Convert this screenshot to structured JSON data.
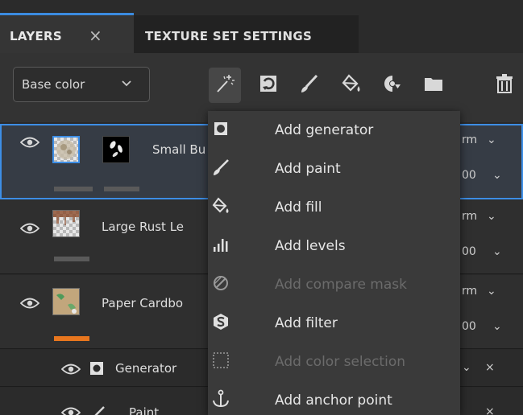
{
  "tabs": {
    "layers_label": "LAYERS",
    "layers_close": "×",
    "texture_set_label": "TEXTURE SET SETTINGS"
  },
  "toolbar": {
    "channel_value": "Base color",
    "buttons": [
      {
        "icon": "magic-wand-icon"
      },
      {
        "icon": "smart-mask-icon"
      },
      {
        "icon": "brush-icon"
      },
      {
        "icon": "fill-bucket-icon"
      },
      {
        "icon": "mask-icon"
      },
      {
        "icon": "folder-icon"
      },
      {
        "icon": "trash-icon"
      }
    ]
  },
  "layers": [
    {
      "name": "Small Bu",
      "blend": "rm",
      "opacity": "00"
    },
    {
      "name": "Large Rust Le",
      "blend": "rm",
      "opacity": "00"
    },
    {
      "name": "Paper Cardbo",
      "blend": "rm",
      "opacity": "00"
    },
    {
      "name": "Generator"
    },
    {
      "name": "Paint"
    }
  ],
  "menu": {
    "items": [
      {
        "label": "Add generator",
        "icon": "generator-icon",
        "enabled": true
      },
      {
        "label": "Add paint",
        "icon": "brush-icon",
        "enabled": true
      },
      {
        "label": "Add fill",
        "icon": "fill-bucket-icon",
        "enabled": true
      },
      {
        "label": "Add levels",
        "icon": "levels-icon",
        "enabled": true
      },
      {
        "label": "Add compare mask",
        "icon": "compare-mask-icon",
        "enabled": false
      },
      {
        "label": "Add filter",
        "icon": "filter-icon",
        "enabled": true
      },
      {
        "label": "Add color selection",
        "icon": "color-selection-icon",
        "enabled": false
      },
      {
        "label": "Add anchor point",
        "icon": "anchor-icon",
        "enabled": true
      }
    ]
  },
  "colors": {
    "accent": "#3b8be0",
    "orange_tag": "#e8761e"
  }
}
